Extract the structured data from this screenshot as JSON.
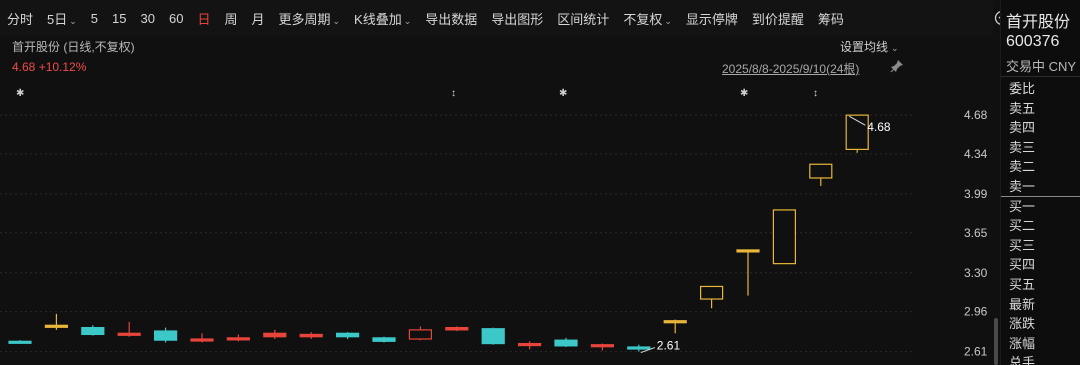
{
  "toolbar": {
    "items": [
      {
        "label": "分时",
        "active": false,
        "caret": false
      },
      {
        "label": "5日",
        "active": false,
        "caret": true
      },
      {
        "label": "5",
        "active": false,
        "caret": false
      },
      {
        "label": "15",
        "active": false,
        "caret": false
      },
      {
        "label": "30",
        "active": false,
        "caret": false
      },
      {
        "label": "60",
        "active": false,
        "caret": false
      },
      {
        "label": "日",
        "active": true,
        "caret": false
      },
      {
        "label": "周",
        "active": false,
        "caret": false
      },
      {
        "label": "月",
        "active": false,
        "caret": false
      },
      {
        "label": "更多周期",
        "active": false,
        "caret": true
      },
      {
        "label": "K线叠加",
        "active": false,
        "caret": true
      },
      {
        "label": "导出数据",
        "active": false,
        "caret": false
      },
      {
        "label": "导出图形",
        "active": false,
        "caret": false
      },
      {
        "label": "区间统计",
        "active": false,
        "caret": false
      },
      {
        "label": "不复权",
        "active": false,
        "caret": true
      },
      {
        "label": "显示停牌",
        "active": false,
        "caret": false
      },
      {
        "label": "到价提醒",
        "active": false,
        "caret": false
      },
      {
        "label": "筹码",
        "active": false,
        "caret": false
      }
    ],
    "icons": [
      "collapse-circle-icon",
      "brush-icon",
      "fullscreen-icon"
    ]
  },
  "chart_header": {
    "title": "首开股份 (日线,不复权)",
    "price_change": "4.68 +10.12%",
    "ma_setting": "设置均线",
    "range": "2025/8/8-2025/9/10(24根)"
  },
  "colors": {
    "up": "#e8443a",
    "down": "#3cc8c8",
    "limit_up": "#e8b63a",
    "flat": "#3cc8c8",
    "axis_text": "#c8c8c8",
    "grid": "#2a2a2a"
  },
  "chart_data": {
    "type": "candlestick",
    "x": [
      "2025/8/8",
      "2025/9/10"
    ],
    "y_ticks": [
      "4.68",
      "4.34",
      "3.99",
      "3.65",
      "3.30",
      "2.96",
      "2.61"
    ],
    "ylim": [
      2.58,
      4.76
    ],
    "candles": [
      {
        "o": 2.7,
        "h": 2.71,
        "l": 2.68,
        "c": 2.7,
        "col": "down"
      },
      {
        "o": 2.83,
        "h": 2.94,
        "l": 2.8,
        "c": 2.84,
        "col": "limit"
      },
      {
        "o": 2.82,
        "h": 2.84,
        "l": 2.75,
        "c": 2.76,
        "col": "down"
      },
      {
        "o": 2.76,
        "h": 2.87,
        "l": 2.74,
        "c": 2.77,
        "col": "up"
      },
      {
        "o": 2.79,
        "h": 2.82,
        "l": 2.69,
        "c": 2.71,
        "col": "down"
      },
      {
        "o": 2.71,
        "h": 2.77,
        "l": 2.69,
        "c": 2.72,
        "col": "up"
      },
      {
        "o": 2.72,
        "h": 2.76,
        "l": 2.7,
        "c": 2.73,
        "col": "up"
      },
      {
        "o": 2.74,
        "h": 2.8,
        "l": 2.72,
        "c": 2.77,
        "col": "up"
      },
      {
        "o": 2.74,
        "h": 2.78,
        "l": 2.72,
        "c": 2.76,
        "col": "up"
      },
      {
        "o": 2.77,
        "h": 2.78,
        "l": 2.72,
        "c": 2.74,
        "col": "down"
      },
      {
        "o": 2.73,
        "h": 2.74,
        "l": 2.69,
        "c": 2.7,
        "col": "down"
      },
      {
        "o": 2.72,
        "h": 2.83,
        "l": 2.71,
        "c": 2.8,
        "col": "up"
      },
      {
        "o": 2.8,
        "h": 2.83,
        "l": 2.79,
        "c": 2.82,
        "col": "up"
      },
      {
        "o": 2.81,
        "h": 2.82,
        "l": 2.67,
        "c": 2.68,
        "col": "down"
      },
      {
        "o": 2.68,
        "h": 2.7,
        "l": 2.63,
        "c": 2.68,
        "col": "up"
      },
      {
        "o": 2.71,
        "h": 2.73,
        "l": 2.65,
        "c": 2.66,
        "col": "down"
      },
      {
        "o": 2.66,
        "h": 2.68,
        "l": 2.62,
        "c": 2.67,
        "col": "up"
      },
      {
        "o": 2.65,
        "h": 2.67,
        "l": 2.61,
        "c": 2.65,
        "col": "down"
      },
      {
        "o": 2.88,
        "h": 2.89,
        "l": 2.77,
        "c": 2.88,
        "col": "limit"
      },
      {
        "o": 3.07,
        "h": 3.18,
        "l": 2.99,
        "c": 3.18,
        "col": "limit"
      },
      {
        "o": 3.5,
        "h": 3.5,
        "l": 3.1,
        "c": 3.5,
        "col": "limit"
      },
      {
        "o": 3.38,
        "h": 3.85,
        "l": 3.38,
        "c": 3.85,
        "col": "limit"
      },
      {
        "o": 4.13,
        "h": 4.25,
        "l": 4.06,
        "c": 4.25,
        "col": "limit"
      },
      {
        "o": 4.38,
        "h": 4.68,
        "l": 4.35,
        "c": 4.68,
        "col": "limit"
      }
    ],
    "annotations": [
      {
        "label": "4.68",
        "candle": 23
      },
      {
        "label": "2.61",
        "candle": 17
      }
    ],
    "event_markers": [
      {
        "candle": 0,
        "glyph": "✱"
      },
      {
        "candle": 6,
        "glyph": "↕"
      },
      {
        "candle": 9,
        "glyph": "✱"
      },
      {
        "candle": 12,
        "glyph": "✱"
      },
      {
        "candle": 14,
        "glyph": "↕"
      }
    ]
  },
  "sidebar": {
    "name": "首开股份",
    "code": "600376",
    "status": "交易中 CNY",
    "rows": [
      "委比",
      "卖五",
      "卖四",
      "卖三",
      "卖二",
      "卖一",
      "买一",
      "买二",
      "买三",
      "买四",
      "买五",
      "最新",
      "涨跌",
      "涨幅",
      "总手"
    ]
  }
}
